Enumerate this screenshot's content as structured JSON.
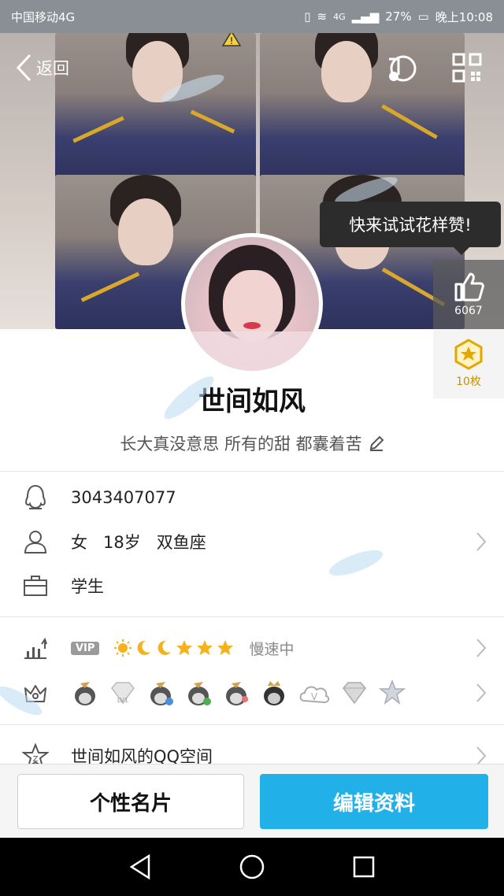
{
  "status_bar": {
    "carrier": "中国移动4G",
    "network": "4G",
    "battery": "27%",
    "time": "晚上10:08"
  },
  "nav": {
    "back_label": "返回"
  },
  "like_tip": "快来试试花样赞!",
  "likes": {
    "count": "6067"
  },
  "badge": {
    "count": "10枚"
  },
  "profile": {
    "nickname": "世间如风",
    "signature": "长大真没意思 所有的甜 都囊着苦"
  },
  "info": {
    "qq_number": "3043407077",
    "gender": "女",
    "age": "18岁",
    "zodiac": "双鱼座",
    "occupation": "学生"
  },
  "level": {
    "vip_label": "VIP",
    "status": "慢速中"
  },
  "qzone": {
    "label": "世间如风的QQ空间"
  },
  "bottom_buttons": {
    "card_label": "个性名片",
    "edit_label": "编辑资料"
  },
  "colors": {
    "accent": "#22b0e9",
    "status_bar": "#8a8f96"
  },
  "icons": [
    "back-icon",
    "music-icon",
    "qr-code-icon",
    "thumb-up-icon",
    "star-badge-icon",
    "qq-penguin-icon",
    "person-icon",
    "briefcase-icon",
    "level-chart-icon",
    "crown-icon",
    "qzone-star-icon",
    "chevron-right-icon",
    "edit-pencil-icon"
  ]
}
